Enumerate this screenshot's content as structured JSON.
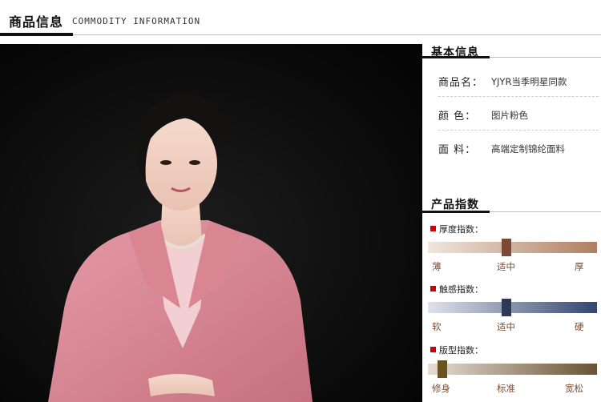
{
  "header": {
    "title_cn": "商品信息",
    "title_en": "COMMODITY INFORMATION"
  },
  "basic_info": {
    "title": "基本信息",
    "rows": [
      {
        "label": "商品名：",
        "value": "YJYR当季明星同款"
      },
      {
        "label": "颜  色：",
        "value": "图片粉色"
      },
      {
        "label": "面  料：",
        "value": "高端定制锦纶面料"
      }
    ]
  },
  "product_index": {
    "title": "产品指数",
    "indices": [
      {
        "label": "厚度指数：",
        "ticks": [
          "薄",
          "适中",
          "厚"
        ],
        "selected": "适中",
        "level": 0.46,
        "gradient": [
          "#efe6df",
          "#b07f61"
        ],
        "knob_color": "#7a4a35"
      },
      {
        "label": "触感指数：",
        "ticks": [
          "软",
          "适中",
          "硬"
        ],
        "selected": "适中",
        "level": 0.46,
        "gradient": [
          "#dfe2ea",
          "#34466f"
        ],
        "knob_color": "#2d3a55"
      },
      {
        "label": "版型指数：",
        "ticks": [
          "修身",
          "标准",
          "宽松"
        ],
        "selected": "修身",
        "level": 0.06,
        "gradient": [
          "#e6ddd4",
          "#6a5233"
        ],
        "knob_color": "#6b5320"
      }
    ]
  },
  "accent_color": "#d40000"
}
